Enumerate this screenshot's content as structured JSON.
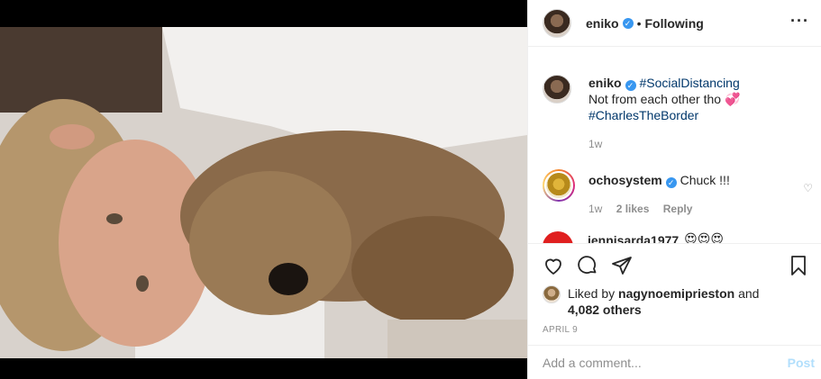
{
  "colors": {
    "accent": "#3897f0",
    "hashtag": "#00376b",
    "muted": "#8e8e8e",
    "post_disabled": "#b2dffc"
  },
  "header": {
    "username": "eniko",
    "separator": "•",
    "follow_status": "Following",
    "more_icon": "more-horizontal-icon"
  },
  "caption": {
    "username": "eniko",
    "hashtag1": "#SocialDistancing",
    "text": "Not from each other tho 💞",
    "hashtag2": "#CharlesTheBorder",
    "time": "1w"
  },
  "comments": [
    {
      "username": "ochosystem",
      "text": "Chuck !!!",
      "time": "1w",
      "likes": "2 likes",
      "reply": "Reply"
    },
    {
      "username": "jennisarda1977",
      "text": "😍😍😍"
    }
  ],
  "actions": {
    "like_icon": "heart-icon",
    "comment_icon": "comment-icon",
    "share_icon": "share-icon",
    "save_icon": "bookmark-icon"
  },
  "likes": {
    "prefix": "Liked by",
    "user": "nagynoemiprieston",
    "and": "and",
    "others": "4,082 others"
  },
  "date": "APRIL 9",
  "add_comment": {
    "placeholder": "Add a comment...",
    "post_label": "Post"
  }
}
